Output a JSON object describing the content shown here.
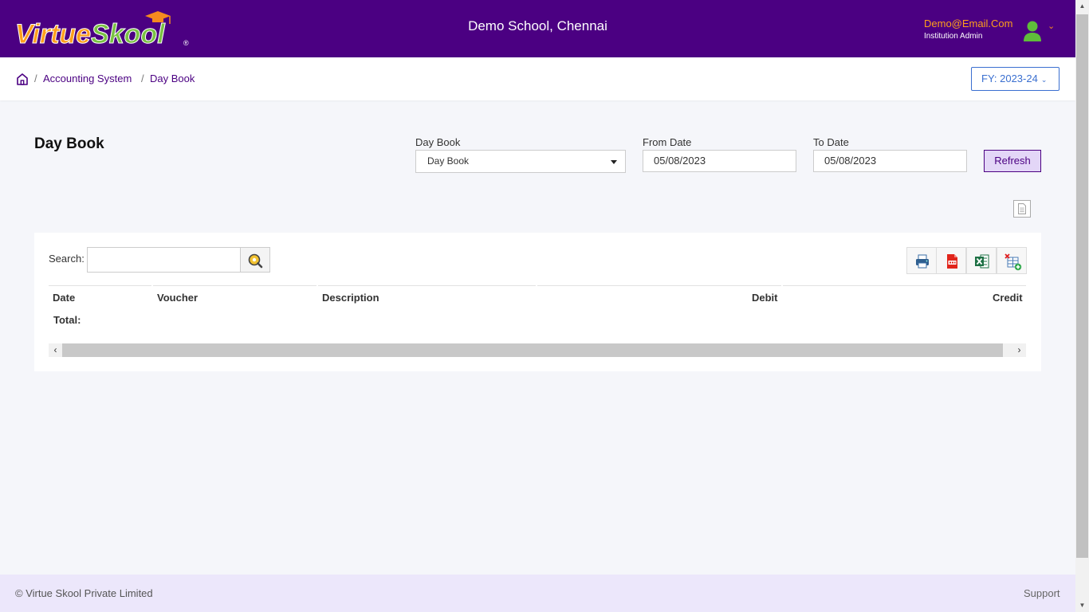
{
  "header": {
    "logo_text_a": "Virtue",
    "logo_text_b": "Skool",
    "school_name": "Demo School, Chennai",
    "user_email": "Demo@Email.Com",
    "user_role": "Institution Admin"
  },
  "breadcrumb": {
    "items": [
      "Accounting System",
      "Day Book"
    ],
    "separator": "/"
  },
  "fy_selector": {
    "label": "FY: 2023-24"
  },
  "page": {
    "title": "Day Book"
  },
  "filters": {
    "type_label": "Day Book",
    "type_value": "Day Book",
    "from_label": "From Date",
    "from_value": "05/08/2023",
    "to_label": "To Date",
    "to_value": "05/08/2023",
    "refresh_label": "Refresh"
  },
  "table": {
    "search_label": "Search:",
    "search_value": "",
    "columns": [
      "Date",
      "Voucher",
      "Description",
      "Debit",
      "Credit"
    ],
    "total_label": "Total:",
    "rows": []
  },
  "toolbar": {
    "icons": [
      "print-icon",
      "pdf-icon",
      "excel-icon",
      "column-visibility-icon"
    ]
  },
  "footer": {
    "copyright": "© Virtue Skool Private Limited",
    "support": "Support"
  },
  "colors": {
    "brand": "#4b0082",
    "accent_orange": "#ff9f1c",
    "logo_green": "#7ac143",
    "footer_bg": "#ece7fb"
  }
}
